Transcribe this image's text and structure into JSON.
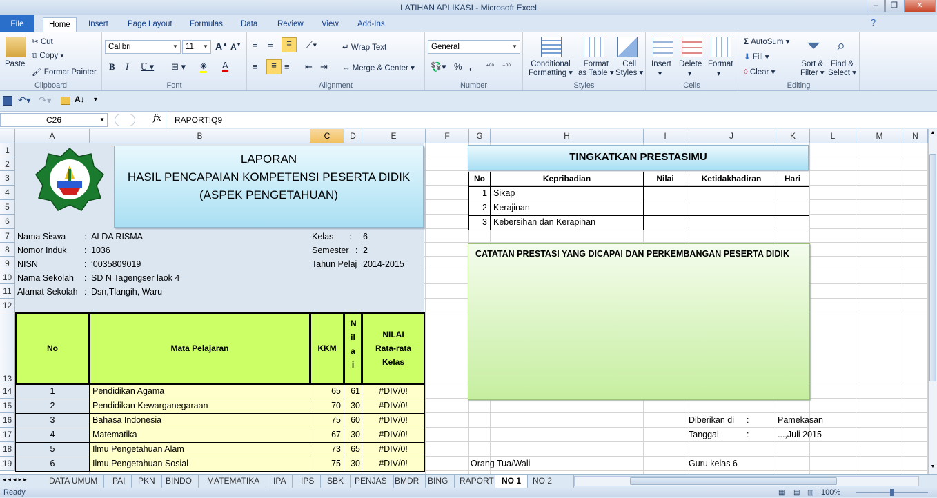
{
  "window": {
    "title": "LATIHAN APLIKASI  -  Microsoft Excel"
  },
  "tabs": [
    "File",
    "Home",
    "Insert",
    "Page Layout",
    "Formulas",
    "Data",
    "Review",
    "View",
    "Add-Ins"
  ],
  "ribbon": {
    "clipboard": {
      "paste": "Paste",
      "cut": "Cut",
      "copy": "Copy",
      "format_painter": "Format Painter",
      "label": "Clipboard"
    },
    "font": {
      "name": "Calibri",
      "size": "11",
      "label": "Font"
    },
    "alignment": {
      "wrap": "Wrap Text",
      "merge": "Merge & Center",
      "label": "Alignment"
    },
    "number": {
      "format": "General",
      "label": "Number"
    },
    "styles": {
      "cond": "Conditional",
      "cond2": "Formatting",
      "fmt": "Format",
      "fmt2": "as Table",
      "cell": "Cell",
      "cell2": "Styles",
      "label": "Styles"
    },
    "cells": {
      "insert": "Insert",
      "delete": "Delete",
      "format": "Format",
      "label": "Cells"
    },
    "editing": {
      "autosum": "AutoSum",
      "fill": "Fill",
      "clear": "Clear",
      "sort": "Sort &",
      "sort2": "Filter",
      "find": "Find &",
      "find2": "Select",
      "label": "Editing"
    }
  },
  "formula_bar": {
    "name_box": "C26",
    "fx": "fx",
    "formula": "=RAPORT!Q9"
  },
  "columns": [
    "A",
    "B",
    "C",
    "D",
    "E",
    "F",
    "G",
    "H",
    "I",
    "J",
    "K",
    "L",
    "M",
    "N"
  ],
  "rows": [
    "1",
    "2",
    "3",
    "4",
    "5",
    "6",
    "7",
    "8",
    "9",
    "10",
    "11",
    "12",
    "13",
    "14",
    "15",
    "16",
    "17",
    "18",
    "19"
  ],
  "report": {
    "title1": "LAPORAN",
    "title2": "HASIL PENCAPAIAN KOMPETENSI PESERTA DIDIK",
    "title3": "(ASPEK PENGETAHUAN)",
    "info": [
      {
        "label": "Nama Siswa",
        "value": "ALDA RISMA"
      },
      {
        "label": "Nomor Induk",
        "value": "1036"
      },
      {
        "label": "NISN",
        "value": "‘0035809019"
      },
      {
        "label": "Nama Sekolah",
        "value": "SD N Tagengser laok 4"
      },
      {
        "label": "Alamat Sekolah",
        "value": "Dsn,Tlangih, Waru"
      }
    ],
    "kelas_label": "Kelas",
    "kelas": "6",
    "semester_label": "Semester",
    "semester": "2",
    "tahun_label": "Tahun Pelaj",
    "tahun": "2014-2015",
    "headers": {
      "no": "No",
      "mapel": "Mata Pelajaran",
      "kkm": "KKM",
      "nilai": "Nilai",
      "rata1": "NILAI",
      "rata2": "Rata-rata",
      "rata3": "Kelas"
    },
    "subjects": [
      {
        "no": "1",
        "name": "Pendidikan Agama",
        "kkm": "65",
        "nilai": "61",
        "rata": "#DIV/0!"
      },
      {
        "no": "2",
        "name": "Pendidikan Kewarganegaraan",
        "kkm": "70",
        "nilai": "30",
        "rata": "#DIV/0!"
      },
      {
        "no": "3",
        "name": "Bahasa Indonesia",
        "kkm": "75",
        "nilai": "60",
        "rata": "#DIV/0!"
      },
      {
        "no": "4",
        "name": "Matematika",
        "kkm": "67",
        "nilai": "30",
        "rata": "#DIV/0!"
      },
      {
        "no": "5",
        "name": "Ilmu Pengetahuan Alam",
        "kkm": "73",
        "nilai": "65",
        "rata": "#DIV/0!"
      },
      {
        "no": "6",
        "name": "Ilmu Pengetahuan Sosial",
        "kkm": "75",
        "nilai": "30",
        "rata": "#DIV/0!"
      }
    ]
  },
  "prestasi": {
    "title": "TINGKATKAN  PRESTASIMU",
    "headers": {
      "no": "No",
      "kepribadian": "Kepribadian",
      "nilai": "Nilai",
      "ketidak": "Ketidakhadiran",
      "hari": "Hari"
    },
    "rows": [
      {
        "no": "1",
        "name": "Sikap"
      },
      {
        "no": "2",
        "name": "Kerajinan"
      },
      {
        "no": "3",
        "name": "Kebersihan dan Kerapihan"
      }
    ],
    "catatan": "CATATAN  PRESTASI YANG DICAPAI DAN PERKEMBANGAN PESERTA DIDIK",
    "diberikan_label": "Diberikan di",
    "diberikan": "Pamekasan",
    "tanggal_label": "Tanggal",
    "tanggal": "...,Juli 2015",
    "ortu": "Orang Tua/Wali",
    "guru": "Guru kelas   6"
  },
  "sheets": [
    "DATA UMUM",
    "PAI",
    "PKN",
    "BINDO",
    "MATEMATIKA",
    "IPA",
    "IPS",
    "SBK",
    "PENJAS",
    "BMDR",
    "BING",
    "RAPORT",
    "NO 1",
    "NO 2"
  ],
  "status": {
    "ready": "Ready",
    "zoom": "100%"
  },
  "colors": {
    "accent": "#2a6fc9",
    "table_header": "#ccff66",
    "row_fill": "#ffffcc",
    "number_fill": "#dce6f1",
    "title_box": "#c5ecf8",
    "note_box": "#d6f5b5"
  }
}
